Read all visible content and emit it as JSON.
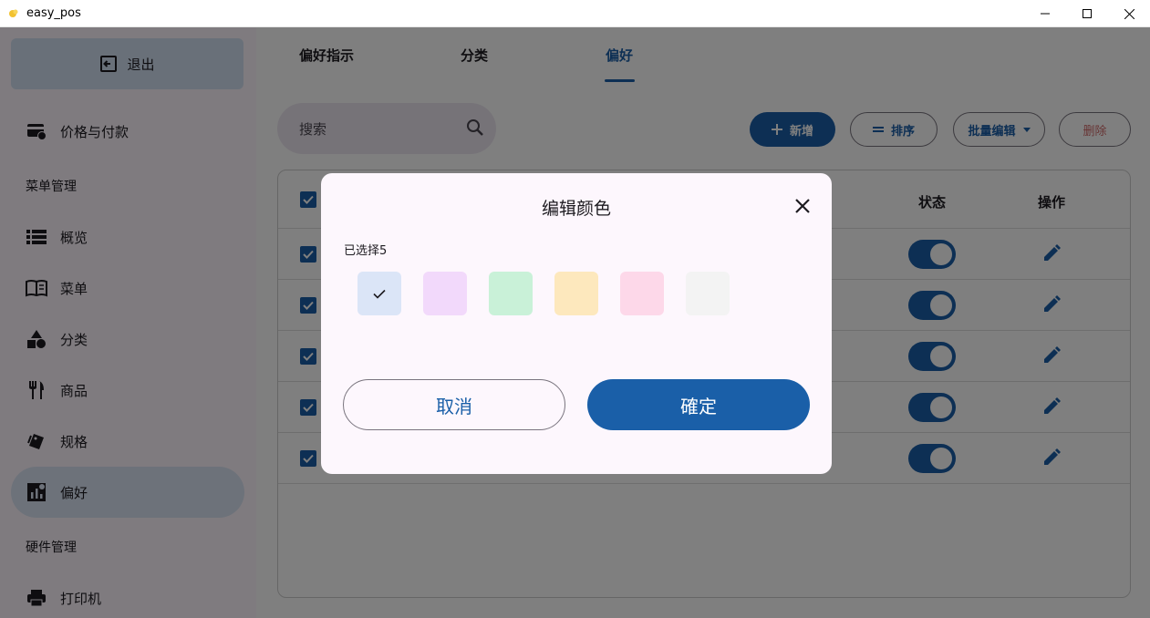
{
  "window": {
    "title": "easy_pos",
    "controls": [
      "minimize-icon",
      "maximize-icon",
      "close-icon"
    ]
  },
  "sidebar": {
    "exit_label": "退出",
    "items": [
      {
        "label": "价格与付款",
        "icon": "payment-icon"
      },
      {
        "label": "概览",
        "icon": "list-icon"
      },
      {
        "label": "菜单",
        "icon": "book-icon"
      },
      {
        "label": "分类",
        "icon": "shapes-icon"
      },
      {
        "label": "商品",
        "icon": "restaurant-icon"
      },
      {
        "label": "规格",
        "icon": "style-icon"
      },
      {
        "label": "偏好",
        "icon": "insights-icon",
        "active": true
      },
      {
        "label": "打印机",
        "icon": "printer-icon"
      }
    ],
    "sections": {
      "menu_management": "菜单管理",
      "hardware_management": "硬件管理"
    }
  },
  "tabs": [
    {
      "label": "偏好指示"
    },
    {
      "label": "分类"
    },
    {
      "label": "偏好",
      "active": true
    }
  ],
  "toolbar": {
    "search_placeholder": "搜索",
    "add_label": "新增",
    "sort_label": "排序",
    "batch_edit_label": "批量编辑",
    "delete_label": "删除"
  },
  "table": {
    "headers": {
      "status": "状态",
      "actions": "操作"
    },
    "rows": [
      {
        "checked": true,
        "enabled": true
      },
      {
        "checked": true,
        "enabled": true
      },
      {
        "checked": true,
        "enabled": true
      },
      {
        "checked": true,
        "enabled": true
      },
      {
        "checked": true,
        "enabled": true
      }
    ]
  },
  "dialog": {
    "title": "编辑颜色",
    "selected_text": "已选择5",
    "swatches": [
      {
        "color": "#dbe5f7",
        "selected": true
      },
      {
        "color": "#f2d9fb",
        "selected": false
      },
      {
        "color": "#c9f1d8",
        "selected": false
      },
      {
        "color": "#fde8bd",
        "selected": false
      },
      {
        "color": "#fdd8e9",
        "selected": false
      },
      {
        "color": "#f3f3f3",
        "selected": false
      }
    ],
    "cancel_label": "取消",
    "confirm_label": "確定"
  },
  "colors": {
    "primary": "#1a5fa8",
    "delete": "#d06a6a"
  }
}
